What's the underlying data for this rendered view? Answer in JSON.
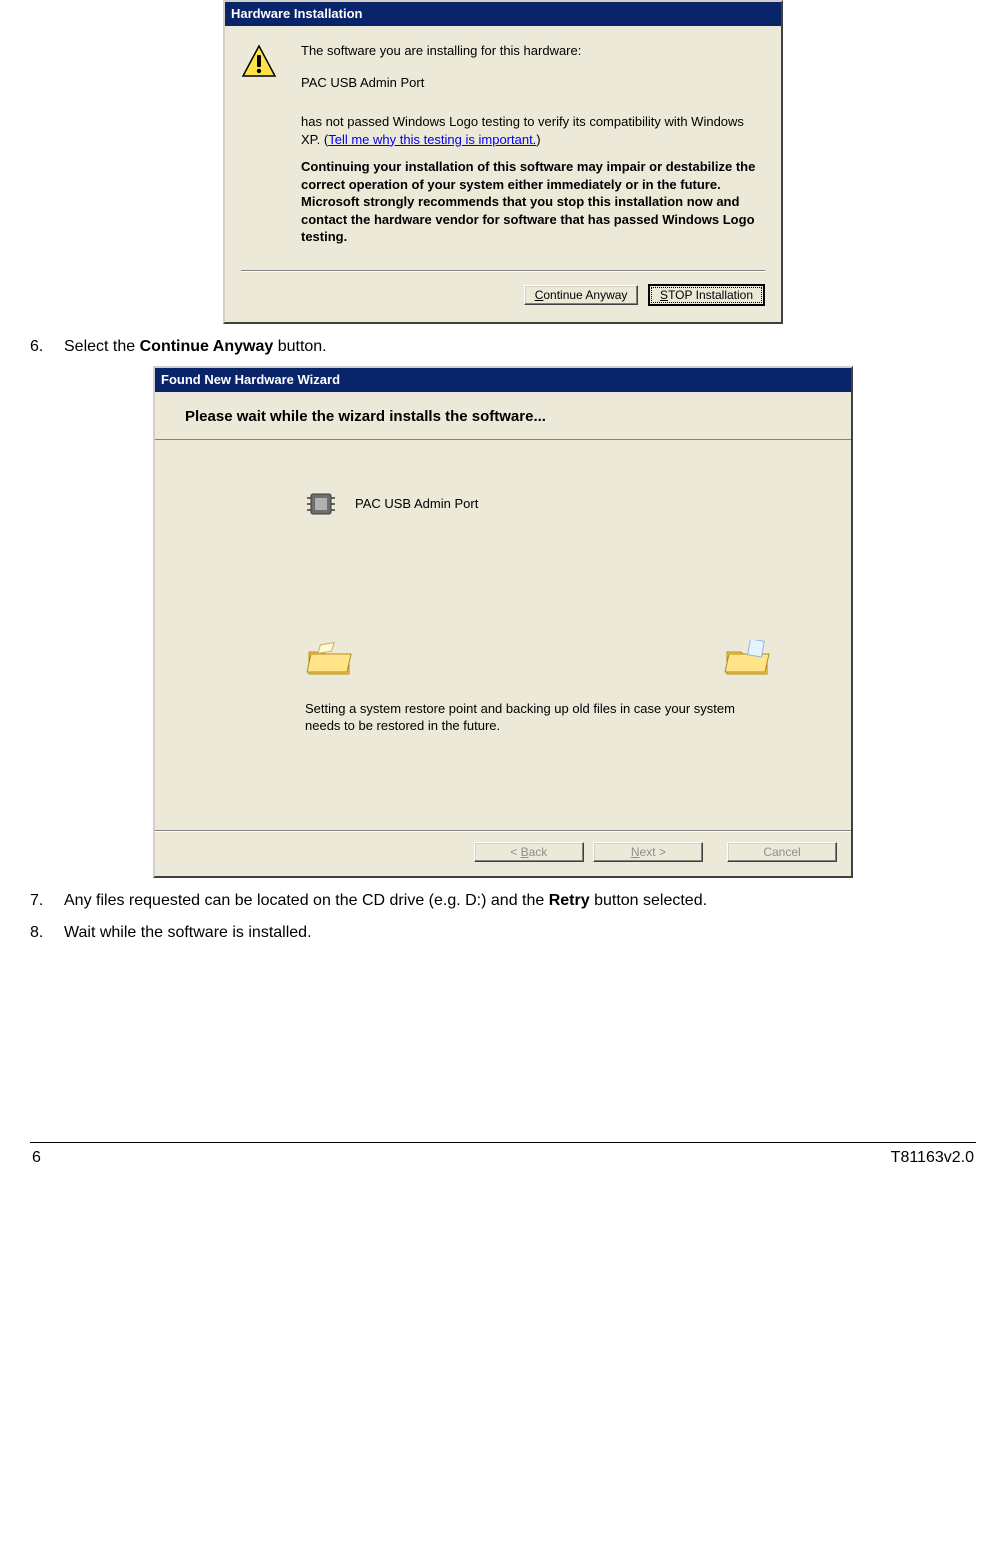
{
  "dialog1": {
    "title": "Hardware Installation",
    "line1": "The software you are installing for this hardware:",
    "device": "PAC USB Admin Port",
    "line2a": "has not passed Windows Logo testing to verify its compatibility with Windows XP. (",
    "link": "Tell me why this testing is important.",
    "line2b": ")",
    "warning": "Continuing your installation of this software may impair or destabilize the correct operation of your system either immediately or in the future. Microsoft strongly recommends that you stop this installation now and contact the hardware vendor for software that has passed Windows Logo testing.",
    "btn_continue_pre": "",
    "btn_continue_u": "C",
    "btn_continue_post": "ontinue Anyway",
    "btn_stop_pre": "",
    "btn_stop_u": "S",
    "btn_stop_post": "TOP Installation"
  },
  "step6": {
    "num": "6.",
    "text_pre": "Select the ",
    "bold": "Continue Anyway",
    "text_post": " button."
  },
  "dialog2": {
    "title": "Found New Hardware Wizard",
    "heading": "Please wait while the wizard installs the software...",
    "device": "PAC USB Admin Port",
    "status": "Setting a system restore point and backing up old files in case your system needs to be restored in the future.",
    "btn_back_pre": "< ",
    "btn_back_u": "B",
    "btn_back_post": "ack",
    "btn_next_pre": "",
    "btn_next_u": "N",
    "btn_next_post": "ext >",
    "btn_cancel": "Cancel"
  },
  "step7": {
    "num": "7.",
    "text_pre": "Any files requested can be located on the CD drive (e.g. D:) and the ",
    "bold": "Retry",
    "text_post": " button selected."
  },
  "step8": {
    "num": "8.",
    "text": "Wait while the software is installed."
  },
  "footer": {
    "page": "6",
    "doc": "T81163v2.0"
  }
}
